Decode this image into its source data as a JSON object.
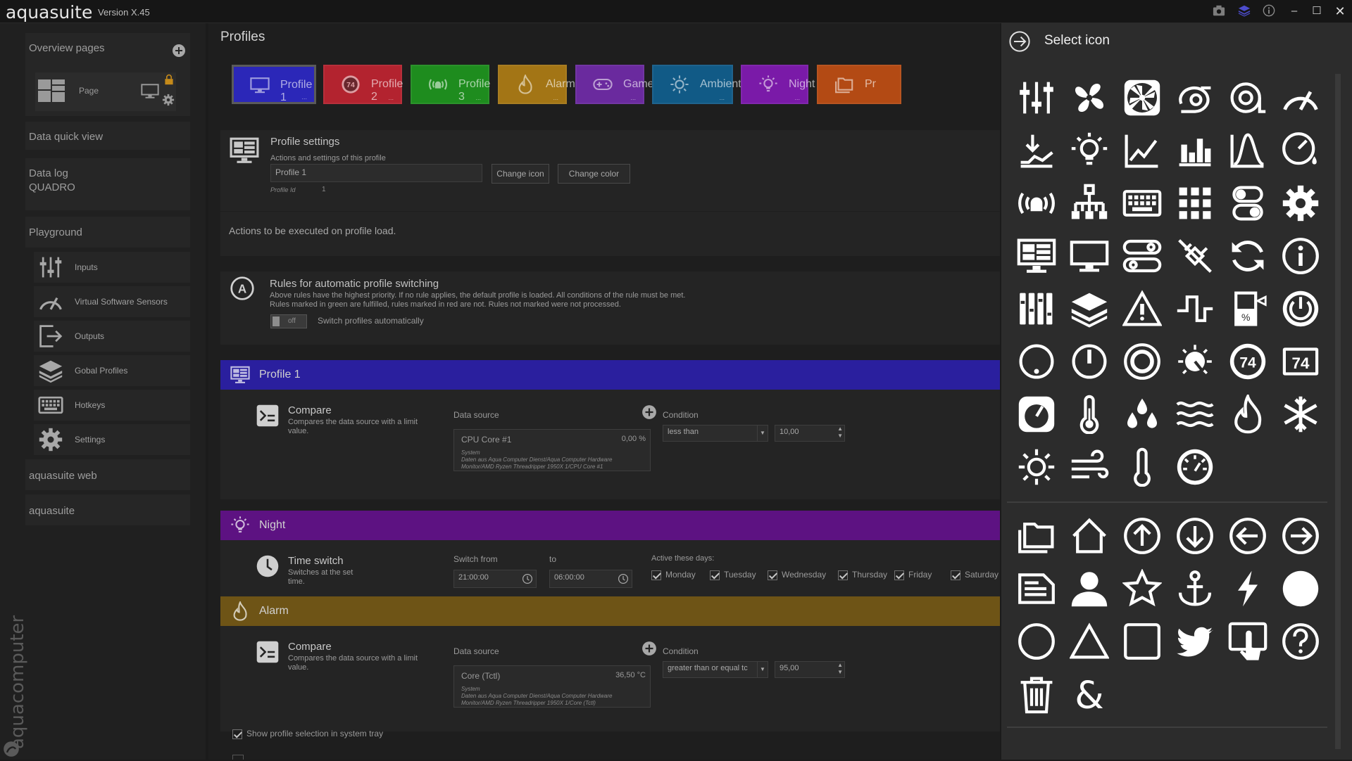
{
  "app": {
    "name": "aquasuite",
    "version": "Version X.45"
  },
  "titlebar": {
    "buttons": [
      "camera-icon",
      "layers-icon",
      "info-icon",
      "minimize-icon",
      "maximize-icon",
      "close-icon"
    ]
  },
  "leftnav": {
    "overview_pages": "Overview pages",
    "page_label": "Page",
    "data_quick_view": "Data quick view",
    "data_log": "Data log",
    "quadro": "QUADRO",
    "playground": "Playground",
    "items": [
      {
        "label": "Inputs",
        "icon": "sliders-icon"
      },
      {
        "label": "Virtual Software Sensors",
        "icon": "gauge-icon"
      },
      {
        "label": "Outputs",
        "icon": "output-icon"
      },
      {
        "label": "Gobal Profiles",
        "icon": "layers-icon"
      },
      {
        "label": "Hotkeys",
        "icon": "keyboard-icon"
      },
      {
        "label": "Settings",
        "icon": "gear-icon"
      }
    ],
    "aquasuite_web": "aquasuite web",
    "aquasuite": "aquasuite",
    "brand": "aquacomputer"
  },
  "main": {
    "title": "Profiles",
    "tabs": [
      {
        "label": "Profile 1",
        "color": "#2b27b8",
        "icon": "monitor-icon"
      },
      {
        "label": "Profile 2",
        "color": "#b3232f",
        "icon": "gauge74-icon"
      },
      {
        "label": "Profile 3",
        "color": "#1e8c1e",
        "icon": "alarm-icon"
      },
      {
        "label": "Alarm",
        "color": "#a37515",
        "icon": "flame-icon"
      },
      {
        "label": "Game",
        "color": "#6a2a9e",
        "icon": "gamepad-icon"
      },
      {
        "label": "Ambient",
        "color": "#115a86",
        "icon": "sun-icon"
      },
      {
        "label": "Night",
        "color": "#7a1aa8",
        "icon": "bulb-icon"
      },
      {
        "label": "Pr",
        "color": "#b34a14",
        "icon": "folder-icon"
      }
    ],
    "tab_dots": "...",
    "profile_settings": {
      "title": "Profile settings",
      "subtitle": "Actions and settings of this profile",
      "name_value": "Profile 1",
      "change_icon": "Change icon",
      "change_color": "Change color",
      "profile_id_label": "Profile Id",
      "profile_id_value": "1"
    },
    "actions_on_load": "Actions to be executed on profile load.",
    "rules": {
      "title": "Rules for automatic profile switching",
      "line1": "Above rules have the highest priority. If no rule applies, the default profile is loaded. All conditions of the rule must be met.",
      "line2": "Rules marked in green are fulfilled, rules marked in red are not. Rules not marked were not processed.",
      "toggle_state": "off",
      "toggle_label": "Switch profiles automatically"
    },
    "sections": [
      {
        "title": "Profile 1",
        "color": "#2a1f9e",
        "icon": "monitor-icon",
        "rule_title": "Compare",
        "rule_desc": "Compares the data source with a limit value.",
        "data_source_label": "Data source",
        "source_name": "CPU Core #1",
        "source_value": "0,00 %",
        "source_sys": "System",
        "source_path": "Daten aus Aqua Computer Dienst/Aqua Computer Hardware Monitor/AMD Ryzen Threadripper 1950X 1/CPU Core #1",
        "condition_label": "Condition",
        "condition_value": "less than",
        "limit_value": "10,00"
      },
      {
        "title": "Night",
        "color": "#5d1282",
        "icon": "bulb-icon",
        "rule_title": "Time switch",
        "rule_desc": "Switches at the set time.",
        "switch_from_label": "Switch from",
        "switch_from": "21:00:00",
        "to_label": "to",
        "to_value": "06:00:00",
        "days_label": "Active these days:",
        "days": [
          "Monday",
          "Tuesday",
          "Wednesday",
          "Thursday",
          "Friday",
          "Saturday"
        ]
      },
      {
        "title": "Alarm",
        "color": "#6e5416",
        "icon": "flame-icon",
        "rule_title": "Compare",
        "rule_desc": "Compares the data source with a limit value.",
        "data_source_label": "Data source",
        "source_name": "Core (Tctl)",
        "source_value": "36,50 °C",
        "source_sys": "System",
        "source_path": "Daten aus Aqua Computer Dienst/Aqua Computer Hardware Monitor/AMD Ryzen Threadripper 1950X 1/Core (Tctl)",
        "condition_label": "Condition",
        "condition_value": "greater than or equal tc",
        "limit_value": "95,00"
      }
    ],
    "tray_option": "Show profile selection in system tray"
  },
  "icon_panel": {
    "title": "Select icon",
    "icons": [
      "sliders-icon",
      "fan-icon",
      "fan-box-icon",
      "pump-icon",
      "pump2-icon",
      "gauge-icon",
      "hand-water-icon",
      "bulb-icon",
      "line-chart-icon",
      "bar-chart-icon",
      "curve-icon",
      "gauge-drop-icon",
      "alarm-icon",
      "network-icon",
      "keyboard-icon",
      "grid-icon",
      "toggles-icon",
      "gear-icon",
      "monitor-dashboard-icon",
      "monitor-icon",
      "switches-icon",
      "plug-off-icon",
      "refresh-icon",
      "info-icon",
      "equalizer-icon",
      "layers-icon",
      "warning-icon",
      "signal-step-icon",
      "tank-percent-icon",
      "power-icon",
      "dial-low-icon",
      "dial-mid-icon",
      "dial-ring-icon",
      "dial-ticks-icon",
      "gauge74-icon",
      "display74-icon",
      "speedometer-icon",
      "thermometer-icon",
      "drops-icon",
      "waves-icon",
      "flame-icon",
      "snowflake-icon",
      "sun-icon",
      "wind-icon",
      "thermometer-simple-icon",
      "gauge-face-icon",
      "folder-icon",
      "home-icon",
      "arrow-up-icon",
      "arrow-down-icon",
      "arrow-left-icon",
      "arrow-right-icon",
      "document-icon",
      "user-icon",
      "star-icon",
      "anchor-icon",
      "bolt-icon",
      "circle-filled-icon",
      "circle-icon",
      "triangle-icon",
      "square-icon",
      "twitter-icon",
      "touch-icon",
      "question-icon",
      "trash-icon",
      "ampersand-icon"
    ]
  }
}
